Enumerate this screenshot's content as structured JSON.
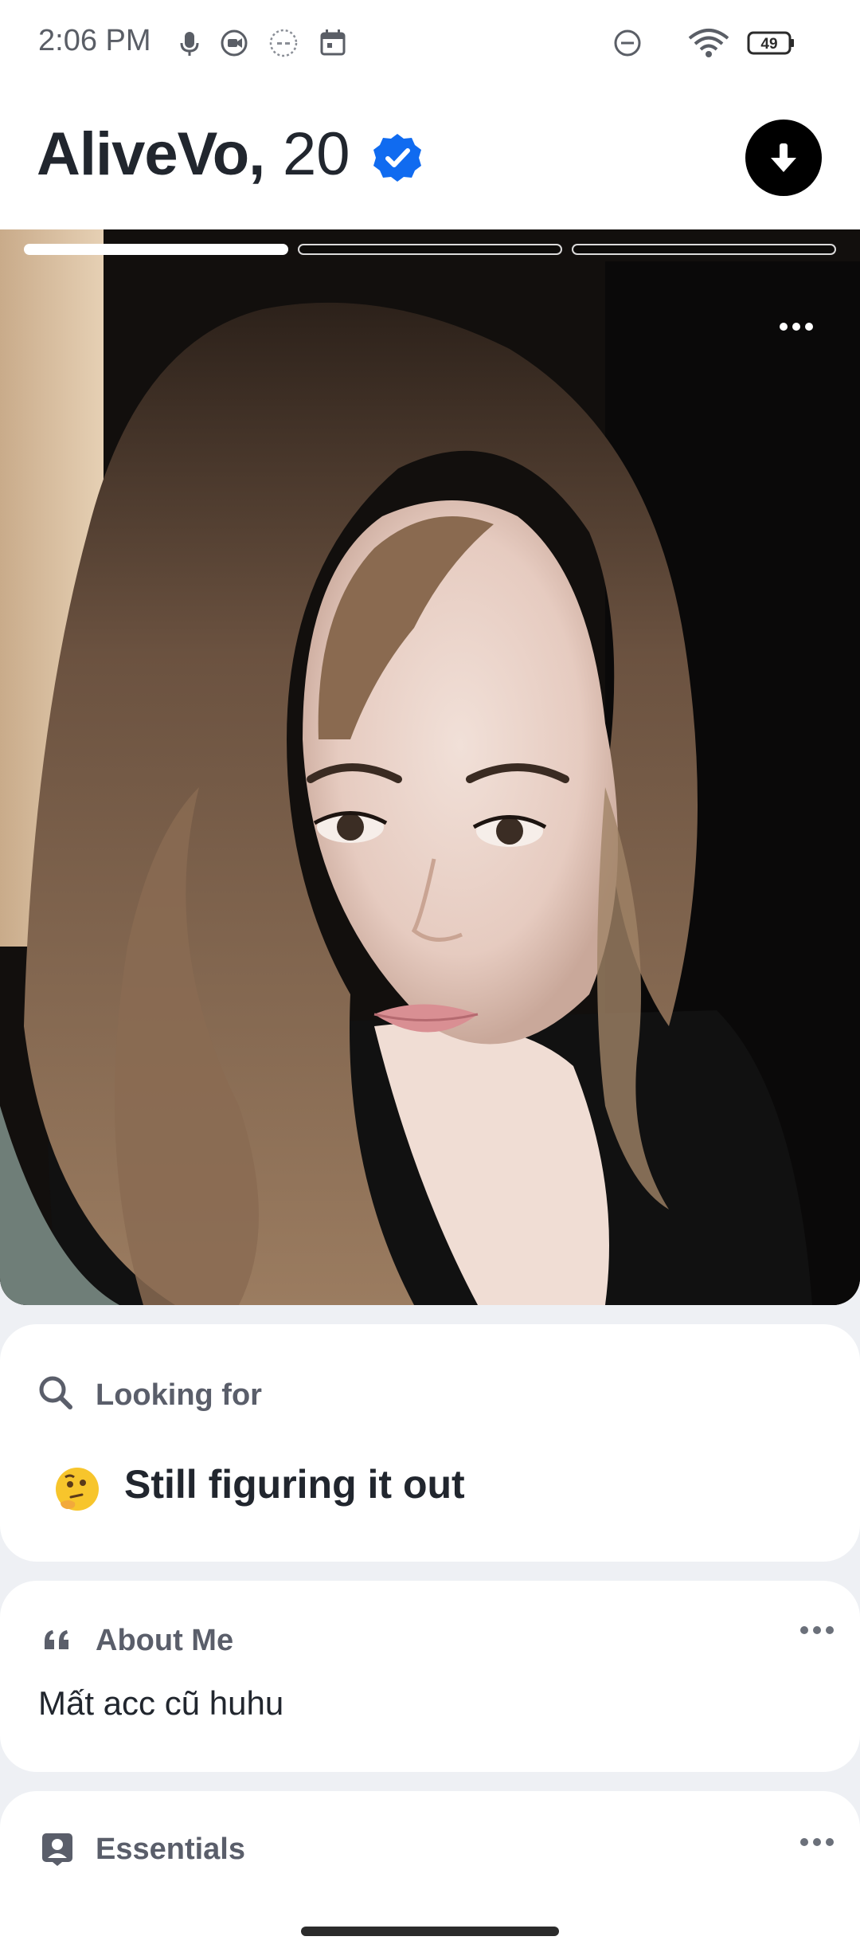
{
  "status_bar": {
    "time": "2:06 PM",
    "battery": "49"
  },
  "profile": {
    "name": "AliveVo,",
    "age": "20",
    "verified": true,
    "photo_count": 3,
    "active_photo": 1
  },
  "looking_for": {
    "title": "Looking for",
    "value": "Still figuring it out",
    "emoji": "thinking-face"
  },
  "about": {
    "title": "About Me",
    "text": "Mất acc cũ huhu"
  },
  "essentials": {
    "title": "Essentials"
  },
  "colors": {
    "verified_blue": "#106bf0",
    "text_primary": "#21262e",
    "text_secondary": "#5a5e6a",
    "background": "#eef0f4"
  }
}
